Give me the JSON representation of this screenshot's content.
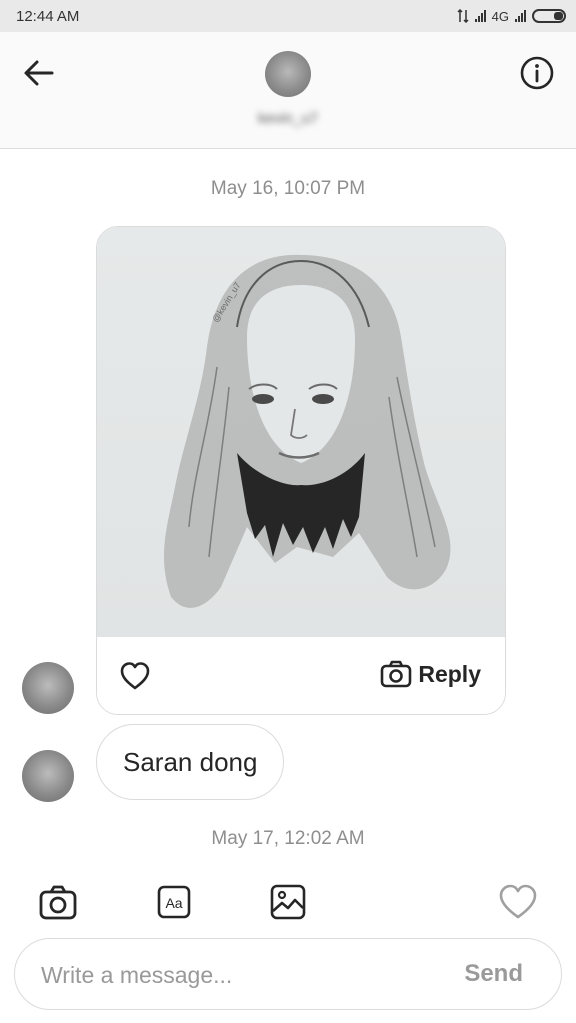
{
  "status_bar": {
    "time": "12:44 AM",
    "network": "4G"
  },
  "header": {
    "username": "kevin_u7"
  },
  "thread": {
    "timestamp_1": "May 16, 10:07 PM",
    "shared_post": {
      "reply_label": "Reply"
    },
    "message_1": "Saran dong",
    "timestamp_2": "May 17, 12:02 AM"
  },
  "composer": {
    "placeholder": "Write a message...",
    "send_label": "Send"
  },
  "icons": {
    "back": "back-arrow-icon",
    "info": "info-icon",
    "like": "heart-icon",
    "reply": "camera-icon",
    "toolbar": [
      "camera-icon",
      "text-style-icon",
      "gallery-icon",
      "heart-icon"
    ]
  }
}
